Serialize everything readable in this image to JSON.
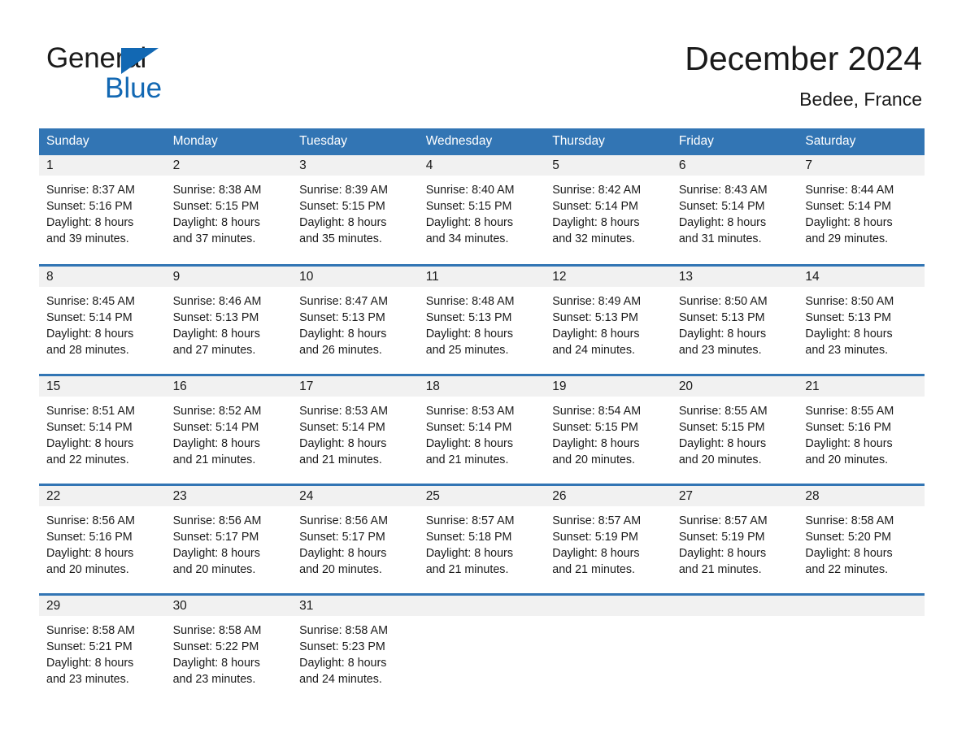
{
  "logo": {
    "word_one": "General",
    "word_two": "Blue",
    "triangle_icon": "triangle-icon",
    "brand_color": "#1268b3"
  },
  "header": {
    "title": "December 2024",
    "subtitle": "Bedee, France"
  },
  "theme": {
    "header_blue": "#3275b4",
    "daynum_band": "#f1f1f1",
    "text": "#1a1a1a"
  },
  "calendar": {
    "weekday_headers": [
      "Sunday",
      "Monday",
      "Tuesday",
      "Wednesday",
      "Thursday",
      "Friday",
      "Saturday"
    ],
    "weeks": [
      [
        {
          "day": "1",
          "sunrise": "Sunrise: 8:37 AM",
          "sunset": "Sunset: 5:16 PM",
          "daylight_line1": "Daylight: 8 hours",
          "daylight_line2": "and 39 minutes."
        },
        {
          "day": "2",
          "sunrise": "Sunrise: 8:38 AM",
          "sunset": "Sunset: 5:15 PM",
          "daylight_line1": "Daylight: 8 hours",
          "daylight_line2": "and 37 minutes."
        },
        {
          "day": "3",
          "sunrise": "Sunrise: 8:39 AM",
          "sunset": "Sunset: 5:15 PM",
          "daylight_line1": "Daylight: 8 hours",
          "daylight_line2": "and 35 minutes."
        },
        {
          "day": "4",
          "sunrise": "Sunrise: 8:40 AM",
          "sunset": "Sunset: 5:15 PM",
          "daylight_line1": "Daylight: 8 hours",
          "daylight_line2": "and 34 minutes."
        },
        {
          "day": "5",
          "sunrise": "Sunrise: 8:42 AM",
          "sunset": "Sunset: 5:14 PM",
          "daylight_line1": "Daylight: 8 hours",
          "daylight_line2": "and 32 minutes."
        },
        {
          "day": "6",
          "sunrise": "Sunrise: 8:43 AM",
          "sunset": "Sunset: 5:14 PM",
          "daylight_line1": "Daylight: 8 hours",
          "daylight_line2": "and 31 minutes."
        },
        {
          "day": "7",
          "sunrise": "Sunrise: 8:44 AM",
          "sunset": "Sunset: 5:14 PM",
          "daylight_line1": "Daylight: 8 hours",
          "daylight_line2": "and 29 minutes."
        }
      ],
      [
        {
          "day": "8",
          "sunrise": "Sunrise: 8:45 AM",
          "sunset": "Sunset: 5:14 PM",
          "daylight_line1": "Daylight: 8 hours",
          "daylight_line2": "and 28 minutes."
        },
        {
          "day": "9",
          "sunrise": "Sunrise: 8:46 AM",
          "sunset": "Sunset: 5:13 PM",
          "daylight_line1": "Daylight: 8 hours",
          "daylight_line2": "and 27 minutes."
        },
        {
          "day": "10",
          "sunrise": "Sunrise: 8:47 AM",
          "sunset": "Sunset: 5:13 PM",
          "daylight_line1": "Daylight: 8 hours",
          "daylight_line2": "and 26 minutes."
        },
        {
          "day": "11",
          "sunrise": "Sunrise: 8:48 AM",
          "sunset": "Sunset: 5:13 PM",
          "daylight_line1": "Daylight: 8 hours",
          "daylight_line2": "and 25 minutes."
        },
        {
          "day": "12",
          "sunrise": "Sunrise: 8:49 AM",
          "sunset": "Sunset: 5:13 PM",
          "daylight_line1": "Daylight: 8 hours",
          "daylight_line2": "and 24 minutes."
        },
        {
          "day": "13",
          "sunrise": "Sunrise: 8:50 AM",
          "sunset": "Sunset: 5:13 PM",
          "daylight_line1": "Daylight: 8 hours",
          "daylight_line2": "and 23 minutes."
        },
        {
          "day": "14",
          "sunrise": "Sunrise: 8:50 AM",
          "sunset": "Sunset: 5:13 PM",
          "daylight_line1": "Daylight: 8 hours",
          "daylight_line2": "and 23 minutes."
        }
      ],
      [
        {
          "day": "15",
          "sunrise": "Sunrise: 8:51 AM",
          "sunset": "Sunset: 5:14 PM",
          "daylight_line1": "Daylight: 8 hours",
          "daylight_line2": "and 22 minutes."
        },
        {
          "day": "16",
          "sunrise": "Sunrise: 8:52 AM",
          "sunset": "Sunset: 5:14 PM",
          "daylight_line1": "Daylight: 8 hours",
          "daylight_line2": "and 21 minutes."
        },
        {
          "day": "17",
          "sunrise": "Sunrise: 8:53 AM",
          "sunset": "Sunset: 5:14 PM",
          "daylight_line1": "Daylight: 8 hours",
          "daylight_line2": "and 21 minutes."
        },
        {
          "day": "18",
          "sunrise": "Sunrise: 8:53 AM",
          "sunset": "Sunset: 5:14 PM",
          "daylight_line1": "Daylight: 8 hours",
          "daylight_line2": "and 21 minutes."
        },
        {
          "day": "19",
          "sunrise": "Sunrise: 8:54 AM",
          "sunset": "Sunset: 5:15 PM",
          "daylight_line1": "Daylight: 8 hours",
          "daylight_line2": "and 20 minutes."
        },
        {
          "day": "20",
          "sunrise": "Sunrise: 8:55 AM",
          "sunset": "Sunset: 5:15 PM",
          "daylight_line1": "Daylight: 8 hours",
          "daylight_line2": "and 20 minutes."
        },
        {
          "day": "21",
          "sunrise": "Sunrise: 8:55 AM",
          "sunset": "Sunset: 5:16 PM",
          "daylight_line1": "Daylight: 8 hours",
          "daylight_line2": "and 20 minutes."
        }
      ],
      [
        {
          "day": "22",
          "sunrise": "Sunrise: 8:56 AM",
          "sunset": "Sunset: 5:16 PM",
          "daylight_line1": "Daylight: 8 hours",
          "daylight_line2": "and 20 minutes."
        },
        {
          "day": "23",
          "sunrise": "Sunrise: 8:56 AM",
          "sunset": "Sunset: 5:17 PM",
          "daylight_line1": "Daylight: 8 hours",
          "daylight_line2": "and 20 minutes."
        },
        {
          "day": "24",
          "sunrise": "Sunrise: 8:56 AM",
          "sunset": "Sunset: 5:17 PM",
          "daylight_line1": "Daylight: 8 hours",
          "daylight_line2": "and 20 minutes."
        },
        {
          "day": "25",
          "sunrise": "Sunrise: 8:57 AM",
          "sunset": "Sunset: 5:18 PM",
          "daylight_line1": "Daylight: 8 hours",
          "daylight_line2": "and 21 minutes."
        },
        {
          "day": "26",
          "sunrise": "Sunrise: 8:57 AM",
          "sunset": "Sunset: 5:19 PM",
          "daylight_line1": "Daylight: 8 hours",
          "daylight_line2": "and 21 minutes."
        },
        {
          "day": "27",
          "sunrise": "Sunrise: 8:57 AM",
          "sunset": "Sunset: 5:19 PM",
          "daylight_line1": "Daylight: 8 hours",
          "daylight_line2": "and 21 minutes."
        },
        {
          "day": "28",
          "sunrise": "Sunrise: 8:58 AM",
          "sunset": "Sunset: 5:20 PM",
          "daylight_line1": "Daylight: 8 hours",
          "daylight_line2": "and 22 minutes."
        }
      ],
      [
        {
          "day": "29",
          "sunrise": "Sunrise: 8:58 AM",
          "sunset": "Sunset: 5:21 PM",
          "daylight_line1": "Daylight: 8 hours",
          "daylight_line2": "and 23 minutes."
        },
        {
          "day": "30",
          "sunrise": "Sunrise: 8:58 AM",
          "sunset": "Sunset: 5:22 PM",
          "daylight_line1": "Daylight: 8 hours",
          "daylight_line2": "and 23 minutes."
        },
        {
          "day": "31",
          "sunrise": "Sunrise: 8:58 AM",
          "sunset": "Sunset: 5:23 PM",
          "daylight_line1": "Daylight: 8 hours",
          "daylight_line2": "and 24 minutes."
        },
        {
          "day": "",
          "sunrise": "",
          "sunset": "",
          "daylight_line1": "",
          "daylight_line2": ""
        },
        {
          "day": "",
          "sunrise": "",
          "sunset": "",
          "daylight_line1": "",
          "daylight_line2": ""
        },
        {
          "day": "",
          "sunrise": "",
          "sunset": "",
          "daylight_line1": "",
          "daylight_line2": ""
        },
        {
          "day": "",
          "sunrise": "",
          "sunset": "",
          "daylight_line1": "",
          "daylight_line2": ""
        }
      ]
    ]
  }
}
